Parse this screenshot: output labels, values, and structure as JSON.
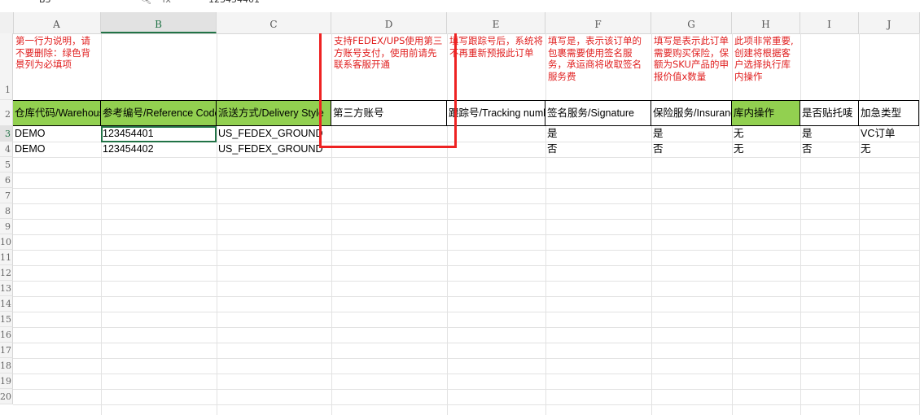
{
  "formula_bar": {
    "name_box": "B3",
    "fx_label": "fx",
    "value": "123454401"
  },
  "columns": [
    "A",
    "B",
    "C",
    "D",
    "E",
    "F",
    "G",
    "H",
    "I",
    "J"
  ],
  "rows": [
    "1",
    "2",
    "3",
    "4",
    "5",
    "6",
    "7",
    "8",
    "9",
    "10",
    "11",
    "12",
    "13",
    "14",
    "15",
    "16",
    "17",
    "18",
    "19",
    "20"
  ],
  "notes": {
    "A": "第一行为说明，请不要删除：绿色背景列为必填项",
    "D": "支持FEDEX/UPS使用第三方账号支付，使用前请先联系客服开通",
    "E": "填写跟踪号后，系统将不再重新预报此订单",
    "F": "填写是，表示该订单的包裹需要使用签名服务，承运商将收取签名服务费",
    "G": "填写是表示此订单需要购买保险，保额为SKU产品的申报价值x数量",
    "H": "此项非常重要,创建将根据客户选择执行库内操作"
  },
  "headers": {
    "A": "仓库代码/Warehouse",
    "B": "参考编号/Reference Code",
    "C": "派送方式/Delivery Style",
    "D": "第三方账号",
    "E": "跟踪号/Tracking number",
    "F": "签名服务/Signature",
    "G": "保险服务/Insurance",
    "H": "库内操作",
    "I": "是否贴托唛",
    "J": "加急类型"
  },
  "data_rows": [
    {
      "A": "DEMO",
      "B": "123454401",
      "C": "US_FEDEX_GROUND",
      "D": "",
      "E": "",
      "F": "是",
      "G": "是",
      "H": "无",
      "I": "是",
      "J": "VC订单"
    },
    {
      "A": "DEMO",
      "B": "123454402",
      "C": "US_FEDEX_GROUND",
      "D": "",
      "E": "",
      "F": "否",
      "G": "否",
      "H": "无",
      "I": "否",
      "J": "无"
    }
  ],
  "colors": {
    "required_header_bg": "#92d050",
    "note_text": "#e02020",
    "highlight_box": "#ee2222",
    "selection": "#217346"
  }
}
